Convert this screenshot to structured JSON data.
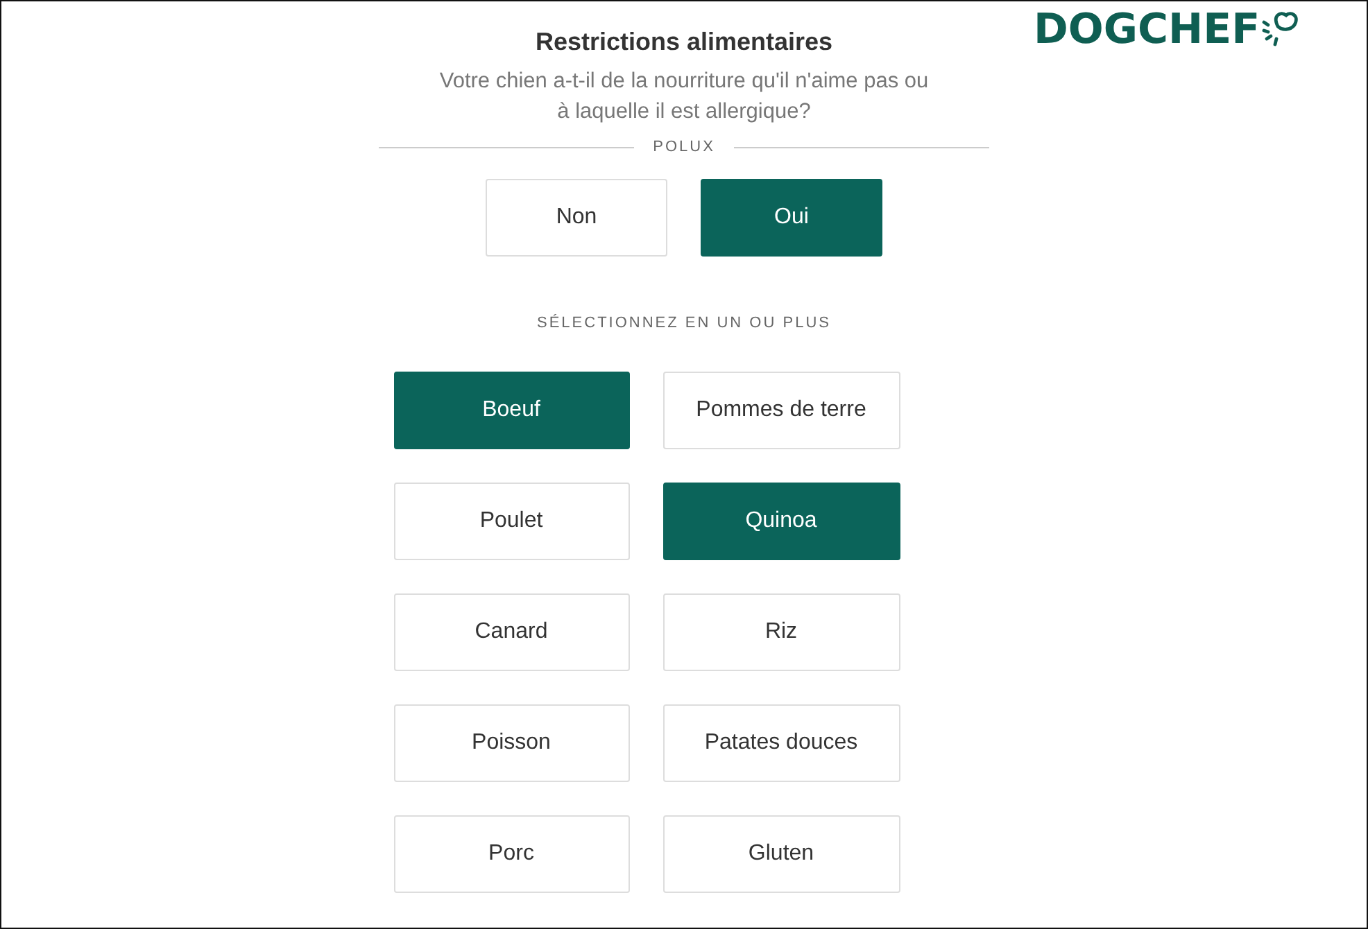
{
  "logo": {
    "text": "DOGCHEF"
  },
  "title": "Restrictions alimentaires",
  "question": "Votre chien a-t-il de la nourriture qu'il n'aime pas ou à laquelle il est allergique?",
  "dog_name": "POLUX",
  "answers": [
    {
      "label": "Non",
      "selected": false
    },
    {
      "label": "Oui",
      "selected": true
    }
  ],
  "options_heading": "SÉLECTIONNEZ EN UN OU PLUS",
  "options": [
    {
      "label": "Boeuf",
      "selected": true
    },
    {
      "label": "Pommes de terre",
      "selected": false
    },
    {
      "label": "Poulet",
      "selected": false
    },
    {
      "label": "Quinoa",
      "selected": true
    },
    {
      "label": "Canard",
      "selected": false
    },
    {
      "label": "Riz",
      "selected": false
    },
    {
      "label": "Poisson",
      "selected": false
    },
    {
      "label": "Patates douces",
      "selected": false
    },
    {
      "label": "Porc",
      "selected": false
    },
    {
      "label": "Gluten",
      "selected": false
    }
  ]
}
